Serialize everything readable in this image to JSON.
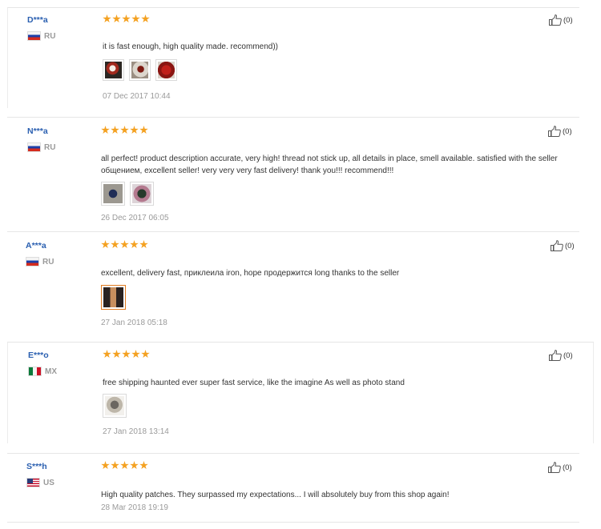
{
  "reviews": [
    {
      "username": "D***a",
      "country": "RU",
      "flag": "ru",
      "rating": 5,
      "likes": "(0)",
      "text": "it is fast enough, high quality made. recommend))",
      "date": "07 Dec 2017 10:44",
      "photos": [
        "review-photo-patch-1",
        "review-photo-patch-2",
        "review-photo-patch-3"
      ]
    },
    {
      "username": "N***a",
      "country": "RU",
      "flag": "ru",
      "rating": 5,
      "likes": "(0)",
      "text": "all perfect! product description accurate, very high! thread not stick up, all details in place, smell available. satisfied with the seller общением, excellent seller! very very very fast delivery! thank you!!! recommend!!!",
      "date": "26 Dec 2017 06:05",
      "photos": [
        "review-photo-star-1",
        "review-photo-star-2"
      ]
    },
    {
      "username": "A***a",
      "country": "RU",
      "flag": "ru",
      "rating": 5,
      "likes": "(0)",
      "text": "excellent, delivery fast, приклеила iron, hope продержится long thanks to the seller",
      "date": "27 Jan 2018 05:18",
      "photos": [
        "review-photo-jacket"
      ]
    },
    {
      "username": "E***o",
      "country": "MX",
      "flag": "mx",
      "rating": 5,
      "likes": "(0)",
      "text": "free shipping haunted ever super fast service, like the imagine As well as photo stand",
      "date": "27 Jan 2018 13:14",
      "photos": [
        "review-photo-patch-pack"
      ]
    },
    {
      "username": "S***h",
      "country": "US",
      "flag": "us",
      "rating": 5,
      "likes": "(0)",
      "text": "High quality patches. They surpassed my expectations... I will absolutely buy from this shop again!",
      "date": "28 Mar 2018 19:19",
      "photos": []
    }
  ],
  "colors": {
    "username": "#2a5fb0",
    "star": "#f4a121",
    "muted": "#9a9a9a",
    "separator": "#e6e6e6"
  },
  "icons": {
    "rating": "star-icon",
    "like": "thumbs-up-icon"
  }
}
